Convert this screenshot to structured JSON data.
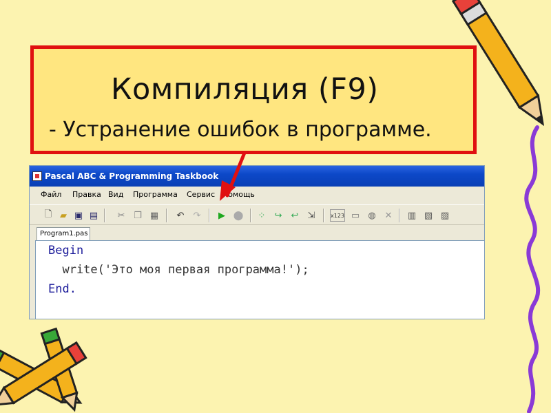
{
  "slide": {
    "title": "Компиляция (F9)",
    "subtitle": "- Устранение ошибок в программе."
  },
  "ide": {
    "window_title": "Pascal ABC & Programming Taskbook",
    "menu": [
      "Файл",
      "Правка",
      "Вид",
      "Программа",
      "Сервис",
      "Помощь"
    ],
    "tab_label": "Program1.pas",
    "code": {
      "line1": "Begin",
      "line2": "  write('Это моя первая программа!');",
      "line3": "End."
    }
  },
  "colors": {
    "title_border": "#e01010",
    "title_bg": "#ffe680",
    "arrow": "#e01010",
    "keyword": "#1b1b9a"
  },
  "icons": [
    "new-file-icon",
    "open-folder-icon",
    "save-icon",
    "save-all-icon",
    "cut-icon",
    "copy-icon",
    "paste-icon",
    "undo-icon",
    "redo-icon",
    "run-icon",
    "stop-icon",
    "step-into-icon",
    "step-over-icon",
    "step-out-icon",
    "goto-icon",
    "watch-icon",
    "window-icon",
    "breakpoint-icon",
    "close-icon",
    "taskbook-icon",
    "results-icon",
    "run-task-icon"
  ]
}
